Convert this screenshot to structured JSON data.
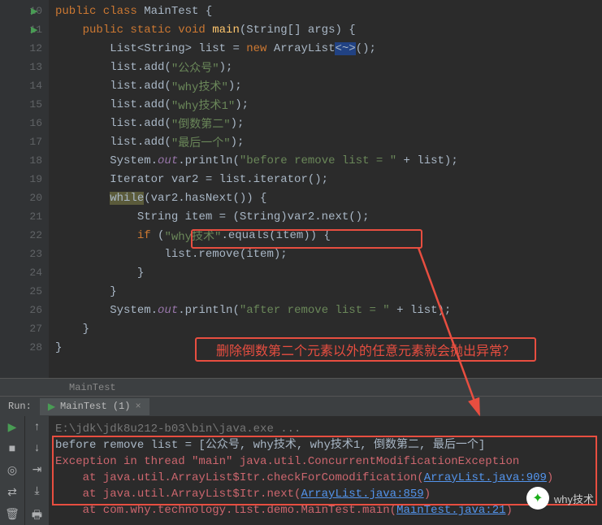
{
  "code": {
    "startLine": 10,
    "lines": [
      {
        "n": 10,
        "run": true,
        "indent": 0,
        "tokens": [
          [
            "kw",
            "public class "
          ],
          [
            "cls",
            "MainTest {"
          ]
        ]
      },
      {
        "n": 11,
        "run": true,
        "indent": 1,
        "tokens": [
          [
            "kw",
            "public static void "
          ],
          [
            "method",
            "main"
          ],
          [
            "punct",
            "(String[] args) {"
          ]
        ]
      },
      {
        "n": 12,
        "indent": 2,
        "tokens": [
          [
            "cls",
            "List<String> list = "
          ],
          [
            "kw",
            "new "
          ],
          [
            "cls",
            "ArrayList"
          ],
          [
            "hl",
            "<~>"
          ],
          [
            "punct",
            "();"
          ]
        ]
      },
      {
        "n": 13,
        "indent": 2,
        "tokens": [
          [
            "cls",
            "list.add("
          ],
          [
            "str",
            "\"公众号\""
          ],
          [
            "punct",
            ");"
          ]
        ]
      },
      {
        "n": 14,
        "indent": 2,
        "tokens": [
          [
            "cls",
            "list.add("
          ],
          [
            "str",
            "\"why技术\""
          ],
          [
            "punct",
            ");"
          ]
        ]
      },
      {
        "n": 15,
        "indent": 2,
        "tokens": [
          [
            "cls",
            "list.add("
          ],
          [
            "str",
            "\"why技术1\""
          ],
          [
            "punct",
            ");"
          ]
        ]
      },
      {
        "n": 16,
        "indent": 2,
        "tokens": [
          [
            "cls",
            "list.add("
          ],
          [
            "str",
            "\"倒数第二\""
          ],
          [
            "punct",
            ");"
          ]
        ]
      },
      {
        "n": 17,
        "indent": 2,
        "tokens": [
          [
            "cls",
            "list.add("
          ],
          [
            "str",
            "\"最后一个\""
          ],
          [
            "punct",
            ");"
          ]
        ]
      },
      {
        "n": 18,
        "indent": 2,
        "tokens": [
          [
            "cls",
            "System."
          ],
          [
            "fld",
            "out"
          ],
          [
            "cls",
            ".println("
          ],
          [
            "str",
            "\"before remove list = \""
          ],
          [
            "cls",
            " + list);"
          ]
        ]
      },
      {
        "n": 19,
        "indent": 2,
        "tokens": [
          [
            "cls",
            "Iterator var2 = list.iterator();"
          ]
        ]
      },
      {
        "n": 20,
        "indent": 2,
        "tokens": [
          [
            "hl-while",
            "while"
          ],
          [
            "cls",
            "(var2.hasNext()) {"
          ]
        ]
      },
      {
        "n": 21,
        "indent": 3,
        "tokens": [
          [
            "cls",
            "String item = (String)var2.next();"
          ]
        ]
      },
      {
        "n": 22,
        "indent": 3,
        "tokens": [
          [
            "kw",
            "if "
          ],
          [
            "punct",
            "("
          ],
          [
            "str",
            "\"why技术\""
          ],
          [
            "cls",
            ".equals(item)) {"
          ]
        ]
      },
      {
        "n": 23,
        "indent": 4,
        "tokens": [
          [
            "cls",
            "list.remove(item);"
          ]
        ]
      },
      {
        "n": 24,
        "indent": 3,
        "tokens": [
          [
            "punct",
            "}"
          ]
        ]
      },
      {
        "n": 25,
        "indent": 2,
        "tokens": [
          [
            "punct",
            "}"
          ]
        ]
      },
      {
        "n": 26,
        "indent": 2,
        "tokens": [
          [
            "cls",
            "System."
          ],
          [
            "fld",
            "out"
          ],
          [
            "cls",
            ".println("
          ],
          [
            "str",
            "\"after remove list = \""
          ],
          [
            "cls",
            " + list);"
          ]
        ]
      },
      {
        "n": 27,
        "indent": 1,
        "tokens": [
          [
            "punct",
            "}"
          ]
        ]
      },
      {
        "n": 28,
        "indent": 0,
        "tokens": [
          [
            "punct",
            "}"
          ]
        ]
      }
    ]
  },
  "callout": "删除倒数第二个元素以外的任意元素就会抛出异常？",
  "breadcrumb": "MainTest",
  "run": {
    "label": "Run:",
    "tab": "MainTest (1)",
    "lines": [
      {
        "segs": [
          [
            "gray",
            "E:\\jdk\\jdk8u212-b03\\bin\\java.exe ..."
          ]
        ]
      },
      {
        "segs": [
          [
            "cls",
            "before remove list = [公众号, why技术, why技术1, 倒数第二, 最后一个]"
          ]
        ]
      },
      {
        "segs": [
          [
            "err",
            "Exception in thread \"main\" java.util.ConcurrentModificationException"
          ]
        ]
      },
      {
        "segs": [
          [
            "err",
            "    at java.util.ArrayList$Itr.checkForComodification("
          ],
          [
            "link",
            "ArrayList.java:909"
          ],
          [
            "err",
            ")"
          ]
        ]
      },
      {
        "segs": [
          [
            "err",
            "    at java.util.ArrayList$Itr.next("
          ],
          [
            "link",
            "ArrayList.java:859"
          ],
          [
            "err",
            ")"
          ]
        ]
      },
      {
        "segs": [
          [
            "err",
            "    at com.why.technology.list.demo.MainTest.main("
          ],
          [
            "link",
            "MainTest.java:21"
          ],
          [
            "err",
            ")"
          ]
        ]
      }
    ]
  },
  "watermark": "why技术"
}
